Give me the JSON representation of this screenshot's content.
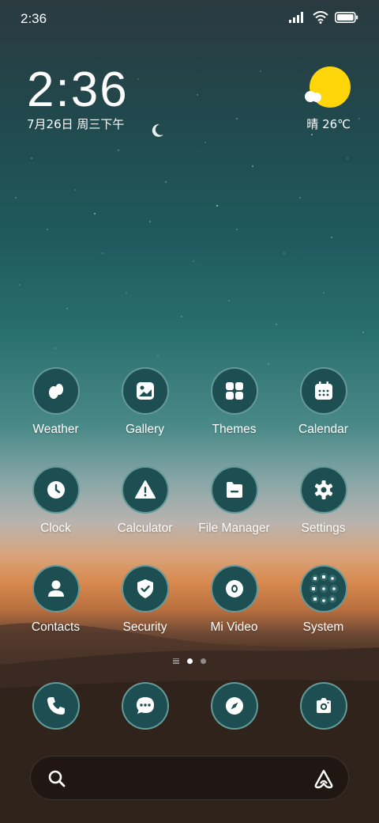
{
  "status_bar": {
    "time": "2:36",
    "icons": [
      "signal-icon",
      "wifi-icon",
      "battery-icon"
    ]
  },
  "clock_widget": {
    "time": "2:36",
    "date": "7月26日 周三下午"
  },
  "weather_widget": {
    "condition_temp": "晴 26℃",
    "icon": "sun-cloud-icon"
  },
  "apps": [
    {
      "label": "Weather",
      "icon": "weather-drops-icon"
    },
    {
      "label": "Gallery",
      "icon": "gallery-icon"
    },
    {
      "label": "Themes",
      "icon": "themes-grid-icon"
    },
    {
      "label": "Calendar",
      "icon": "calendar-icon"
    },
    {
      "label": "Clock",
      "icon": "clock-icon"
    },
    {
      "label": "Calculator",
      "icon": "warning-triangle-icon"
    },
    {
      "label": "File Manager",
      "icon": "folder-icon"
    },
    {
      "label": "Settings",
      "icon": "gear-icon"
    },
    {
      "label": "Contacts",
      "icon": "person-icon"
    },
    {
      "label": "Security",
      "icon": "shield-check-icon"
    },
    {
      "label": "Mi Video",
      "icon": "video-icon"
    },
    {
      "label": "System",
      "icon": "folder-grid-icon"
    }
  ],
  "page_indicator": {
    "pages": 2,
    "active": 1
  },
  "dock": [
    {
      "icon": "phone-icon"
    },
    {
      "icon": "messages-icon"
    },
    {
      "icon": "compass-icon"
    },
    {
      "icon": "camera-icon"
    }
  ],
  "search": {
    "icon": "search-icon",
    "assistant": "assistant-icon"
  },
  "colors": {
    "icon_bg": "#1d4e52",
    "sun": "#ffd60a"
  }
}
